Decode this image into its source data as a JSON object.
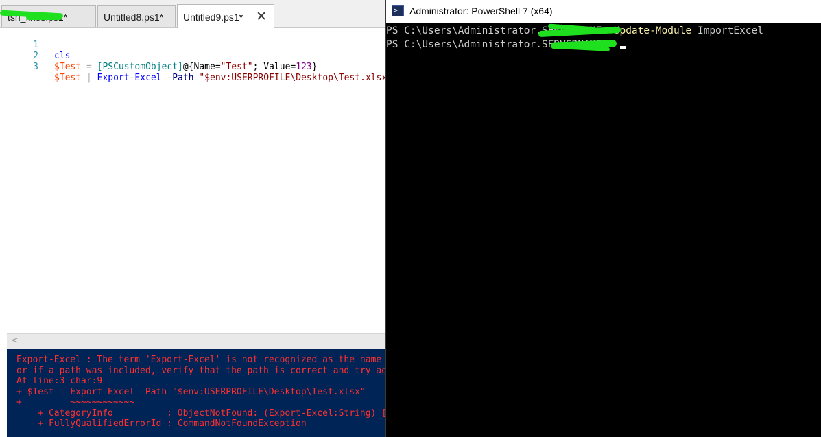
{
  "ise": {
    "tabs": [
      {
        "label": "tsh_fixes.ps1*",
        "active": false
      },
      {
        "label": "Untitled8.ps1*",
        "active": false
      },
      {
        "label": "Untitled9.ps1*",
        "active": true
      }
    ],
    "close_glyph": "✕",
    "editor": {
      "line_numbers": [
        "1",
        "2",
        "3"
      ],
      "line1": {
        "cmd": "cls"
      },
      "line2": {
        "var": "$Test",
        "eq": " = ",
        "type": "[PSCustomObject]",
        "hash_open": "@{Name=",
        "str": "\"Test\"",
        "sep": "; Value=",
        "num": "123",
        "hash_close": "}"
      },
      "line3": {
        "var": "$Test",
        "pipe": " | ",
        "cmd": "Export-Excel",
        "param": " -Path ",
        "str": "\"$env:USERPROFILE\\Desktop\\Test.xlsx\""
      }
    },
    "scroll_left_glyph": "<",
    "console": {
      "lines": [
        "Export-Excel : The term 'Export-Excel' is not recognized as the name of a cmdlet,",
        "or if a path was included, verify that the path is correct and try again.",
        "At line:3 char:9",
        "+ $Test | Export-Excel -Path \"$env:USERPROFILE\\Desktop\\Test.xlsx\"",
        "+         ~~~~~~~~~~~~",
        "    + CategoryInfo          : ObjectNotFound: (Export-Excel:String) [], CommandNotFoundException",
        "    + FullyQualifiedErrorId : CommandNotFoundException"
      ]
    }
  },
  "ps7": {
    "title": "Administrator: PowerShell 7 (x64)",
    "icon_glyph": ">_",
    "lines": [
      {
        "prompt": "PS C:\\Users\\Administrator.SERVERNAME> ",
        "cmd": "Update-Module",
        "arg": " ImportExcel"
      },
      {
        "prompt": "PS C:\\Users\\Administrator.SERVERNAME> ",
        "cmd": "",
        "arg": ""
      }
    ]
  },
  "colors": {
    "console_bg": "#012456",
    "error_text": "#ff3030",
    "redaction_green": "#1fe01f",
    "terminal_command": "#f9f1a5"
  }
}
